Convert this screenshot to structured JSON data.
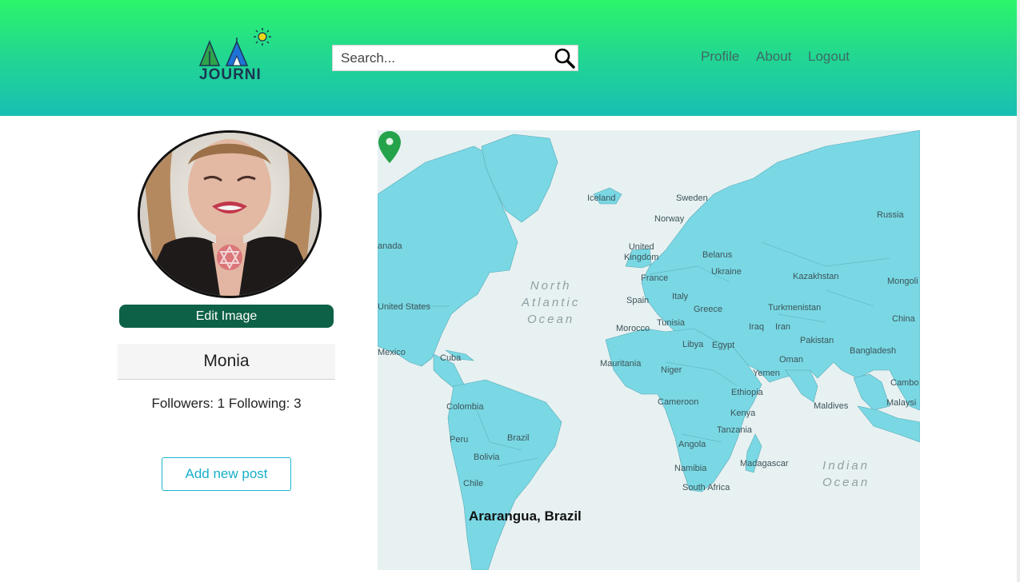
{
  "header": {
    "logo_text": "JOURNI",
    "search_placeholder": "Search...",
    "nav": {
      "profile": "Profile",
      "about": "About",
      "logout": "Logout"
    }
  },
  "profile": {
    "edit_image_label": "Edit Image",
    "username": "Monia",
    "follow_summary": "Followers: 1 Following: 3",
    "add_post_label": "Add new post"
  },
  "map": {
    "marker_label": "Ararangua, Brazil",
    "country_labels": {
      "canada": "anada",
      "united_states": "United States",
      "mexico": "Mexico",
      "cuba": "Cuba",
      "colombia": "Colombia",
      "peru": "Peru",
      "brazil": "Brazil",
      "bolivia": "Bolivia",
      "chile": "Chile",
      "iceland": "Iceland",
      "sweden": "Sweden",
      "norway": "Norway",
      "uk": "United\nKingdom",
      "france": "France",
      "spain": "Spain",
      "italy": "Italy",
      "belarus": "Belarus",
      "ukraine": "Ukraine",
      "greece": "Greece",
      "tunisia": "Tunisia",
      "morocco": "Morocco",
      "libya": "Libya",
      "egypt": "Egypt",
      "mauritania": "Mauritania",
      "niger": "Niger",
      "cameroon": "Cameroon",
      "ethiopia": "Ethiopia",
      "kenya": "Kenya",
      "tanzania": "Tanzania",
      "angola": "Angola",
      "namibia": "Namibia",
      "south_africa": "South Africa",
      "madagascar": "Madagascar",
      "russia": "Russia",
      "kazakhstan": "Kazakhstan",
      "mongolia": "Mongoli",
      "turkmenistan": "Turkmenistan",
      "iraq": "Iraq",
      "iran": "Iran",
      "pakistan": "Pakistan",
      "china": "China",
      "bangladesh": "Bangladesh",
      "oman": "Oman",
      "yemen": "Yemen",
      "cambodia": "Cambo",
      "malaysia": "Malaysi",
      "maldives": "Maldives"
    },
    "ocean_labels": {
      "north_atlantic": "North\nAtlantic\nOcean",
      "indian": "Indian\nOcean"
    }
  },
  "colors": {
    "land": "#79d8e4",
    "water": "#e7f1f2",
    "edit_button": "#0c6146",
    "accent": "#17aec9",
    "pin": "#25a34a"
  }
}
